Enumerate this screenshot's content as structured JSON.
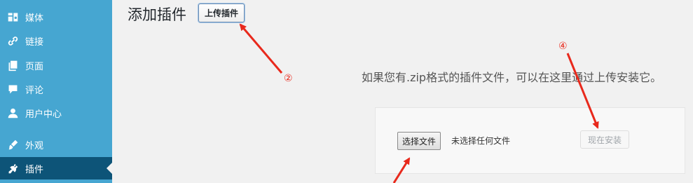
{
  "sidebar": {
    "items": [
      {
        "label": "媒体",
        "icon": "media-icon"
      },
      {
        "label": "链接",
        "icon": "link-icon"
      },
      {
        "label": "页面",
        "icon": "pages-icon"
      },
      {
        "label": "评论",
        "icon": "comments-icon"
      },
      {
        "label": "用户中心",
        "icon": "user-icon"
      },
      {
        "label": "外观",
        "icon": "appearance-icon"
      },
      {
        "label": "插件",
        "icon": "plugins-icon",
        "active": true
      }
    ],
    "colors": {
      "background": "#46a6d1",
      "active": "#0d5478"
    }
  },
  "header": {
    "title": "添加插件",
    "upload_button": "上传插件"
  },
  "upload": {
    "description": "如果您有.zip格式的插件文件，可以在这里通过上传安装它。",
    "choose_file_button": "选择文件",
    "no_file_text": "未选择任何文件",
    "install_button": "现在安装"
  },
  "annotations": {
    "marker_2": "②",
    "marker_4": "④",
    "color": "#e8291c"
  }
}
